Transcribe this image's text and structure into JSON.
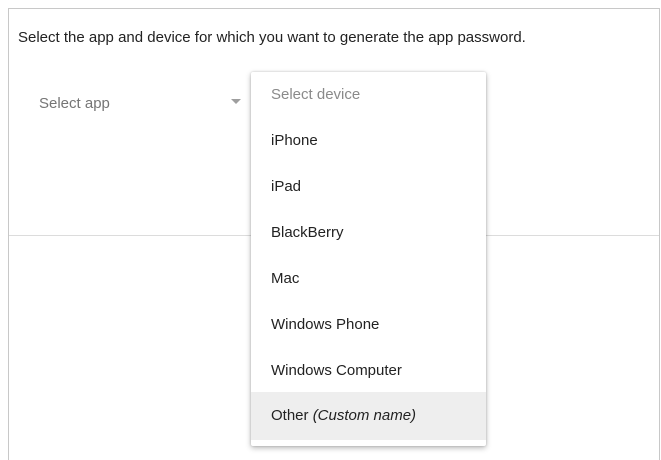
{
  "instruction": "Select the app and device for which you want to generate the app password.",
  "app_select": {
    "label": "Select app",
    "arrow_icon": "dropdown-arrow-icon"
  },
  "device_menu": {
    "placeholder": "Select device",
    "items": [
      {
        "label": "iPhone"
      },
      {
        "label": "iPad"
      },
      {
        "label": "BlackBerry"
      },
      {
        "label": "Mac"
      },
      {
        "label": "Windows Phone"
      },
      {
        "label": "Windows Computer"
      },
      {
        "label": "Other",
        "suffix": "(Custom name)",
        "highlighted": true
      }
    ]
  },
  "colors": {
    "text": "#222222",
    "placeholder": "#757575",
    "highlight": "#eeeeee",
    "border": "#c8c8c8"
  }
}
